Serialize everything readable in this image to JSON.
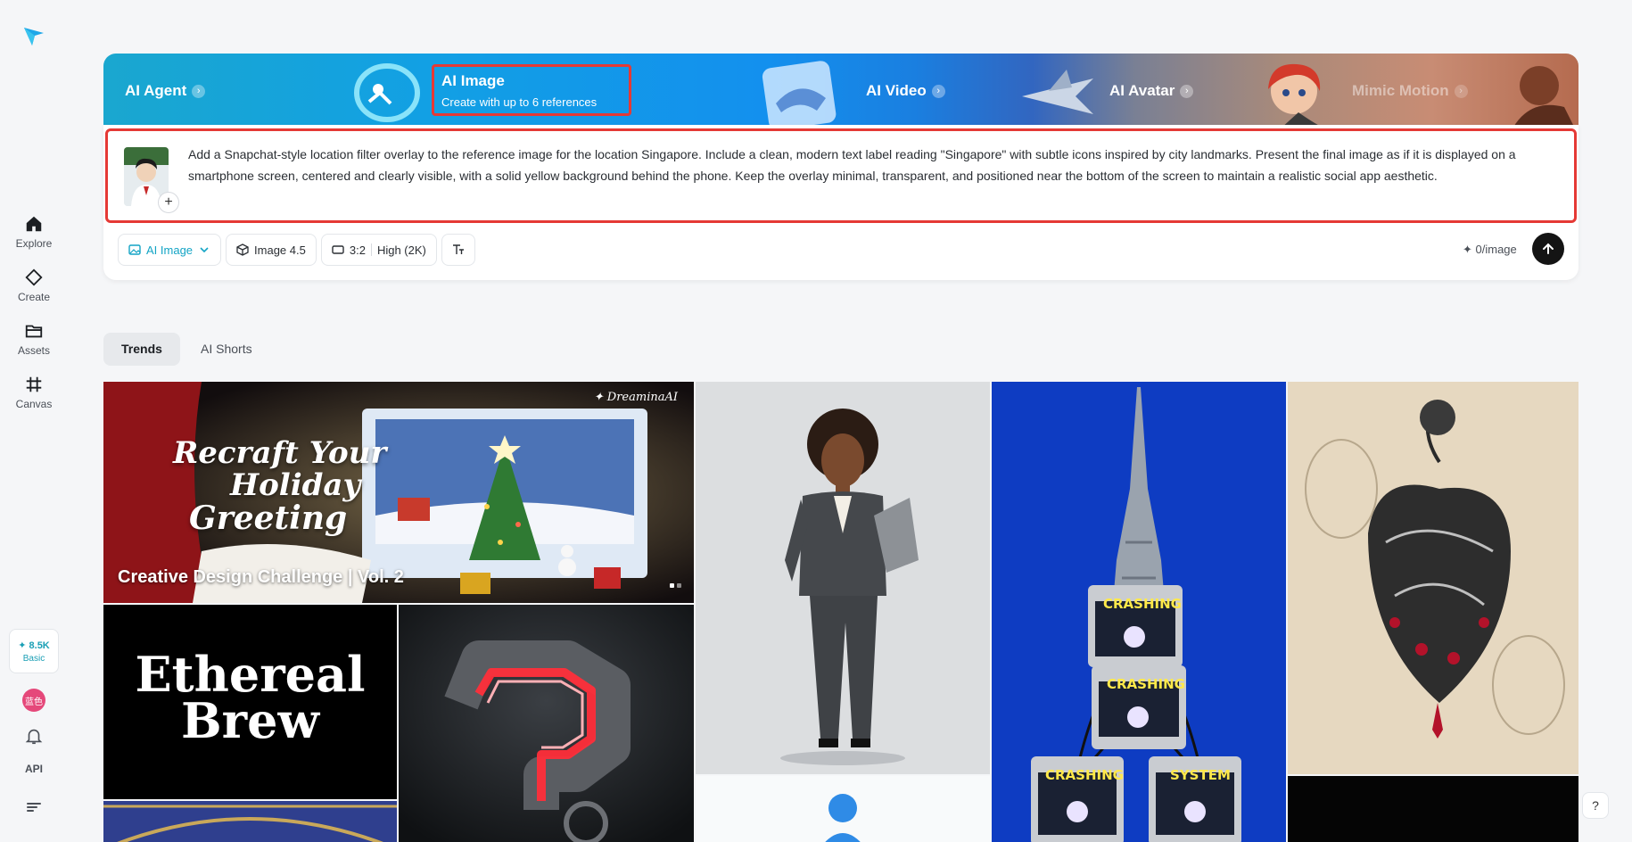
{
  "sidebar": {
    "nav": [
      {
        "label": "Explore",
        "icon": "home-icon"
      },
      {
        "label": "Create",
        "icon": "diamond-icon"
      },
      {
        "label": "Assets",
        "icon": "folder-icon"
      },
      {
        "label": "Canvas",
        "icon": "canvas-icon"
      }
    ],
    "credits": {
      "value": "8.5K",
      "plan": "Basic"
    },
    "avatar_text": "蓝色",
    "api_label": "API"
  },
  "modes": {
    "agent": "AI Agent",
    "image": {
      "title": "AI Image",
      "subtitle": "Create with up to 6 references"
    },
    "video": "AI Video",
    "avatar": "AI Avatar",
    "mimic": "Mimic Motion"
  },
  "prompt": {
    "text": "Add a Snapchat-style location filter overlay to the reference image for the location Singapore. Include a clean, modern text label reading \"Singapore\" with subtle icons inspired by city landmarks. Present the final image as if it is displayed on a smartphone screen, centered and clearly visible, with a solid yellow background behind the phone. Keep the overlay minimal, transparent, and positioned near the bottom of the screen to maintain a realistic social app aesthetic.",
    "add_symbol": "+"
  },
  "toolbar": {
    "mode_label": "AI Image",
    "model_label": "Image 4.5",
    "ratio_label": "3:2",
    "quality_label": "High (2K)",
    "cost_label": "0/image"
  },
  "tabs": {
    "trends": "Trends",
    "shorts": "AI Shorts"
  },
  "gallery": {
    "hero": {
      "script_line1": "Recraft Your",
      "script_line2": "Holiday",
      "script_line3": "Greeting",
      "brand": "DreaminaAI",
      "title": "Creative Design Challenge | Vol. 2"
    },
    "ethereal_line1": "Ethereal",
    "ethereal_line2": "Brew",
    "crash_label": "CRASHING",
    "system_label": "SYSTEM"
  },
  "help_symbol": "?"
}
